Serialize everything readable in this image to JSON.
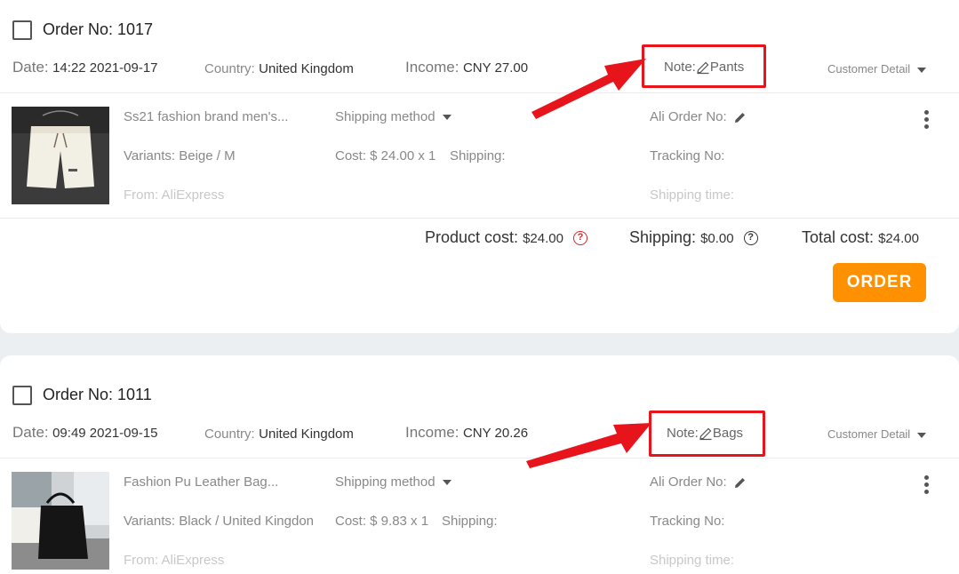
{
  "orders": [
    {
      "order_no": "Order No: 1017",
      "date_label": "Date:",
      "date_value": "14:22 2021-09-17",
      "country_label": "Country:",
      "country_value": "United Kingdom",
      "income_label": "Income:",
      "income_value": "CNY 27.00",
      "note_label": "Note:",
      "note_value": "Pants",
      "customer_detail": "Customer Detail",
      "product_name": "Ss21 fashion brand men's...",
      "shipping_method": "Shipping method",
      "ali_order": "Ali Order No:",
      "variants": "Variants: Beige / M",
      "cost": "Cost: $ 24.00 x 1",
      "shipping_label": "Shipping:",
      "tracking": "Tracking No:",
      "from": "From: AliExpress",
      "shipping_time": "Shipping time:",
      "product_cost_label": "Product cost:",
      "product_cost_value": "$24.00",
      "shipping_total_label": "Shipping:",
      "shipping_total_value": "$0.00",
      "total_cost_label": "Total cost:",
      "total_cost_value": "$24.00",
      "order_button": "ORDER"
    },
    {
      "order_no": "Order No: 1011",
      "date_label": "Date:",
      "date_value": "09:49 2021-09-15",
      "country_label": "Country:",
      "country_value": "United Kingdom",
      "income_label": "Income:",
      "income_value": "CNY 20.26",
      "note_label": "Note:",
      "note_value": "Bags",
      "customer_detail": "Customer Detail",
      "product_name": "Fashion Pu Leather Bag...",
      "shipping_method": "Shipping method",
      "ali_order": "Ali Order No:",
      "variants": "Variants: Black / United Kingdon",
      "cost": "Cost: $ 9.83 x 1",
      "shipping_label": "Shipping:",
      "tracking": "Tracking No:",
      "from": "From: AliExpress",
      "shipping_time": "Shipping time:"
    }
  ],
  "help_icon": "?",
  "colors": {
    "accent": "#ff9000",
    "highlight": "#e8141c"
  }
}
